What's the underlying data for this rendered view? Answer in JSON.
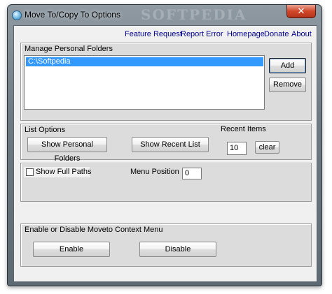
{
  "window": {
    "title": "Move To/Copy To Options",
    "watermark": "SOFTPEDIA",
    "close_glyph": "✕"
  },
  "links": {
    "feature_request": "Feature Request",
    "report_error": "Report Error",
    "homepage": "Homepage",
    "donate": "Donate",
    "about": "About"
  },
  "personal_folders": {
    "title": "Manage Personal Folders",
    "items": [
      "C:\\Softpedia"
    ],
    "add_label": "Add",
    "remove_label": "Remove"
  },
  "list_options": {
    "title": "List Options",
    "show_personal_label": "Show Personal Folders",
    "show_recent_label": "Show Recent List",
    "recent_items_label": "Recent Items",
    "recent_items_value": "10",
    "clear_label": "clear"
  },
  "paths": {
    "show_full_paths_label": "Show Full Paths",
    "show_full_paths_checked": false,
    "menu_position_label": "Menu Position",
    "menu_position_value": "0"
  },
  "context_menu": {
    "title": "Enable or Disable Moveto Context Menu",
    "enable_label": "Enable",
    "disable_label": "Disable"
  },
  "icons": {
    "app": "app-globe-icon",
    "close": "close-icon"
  }
}
